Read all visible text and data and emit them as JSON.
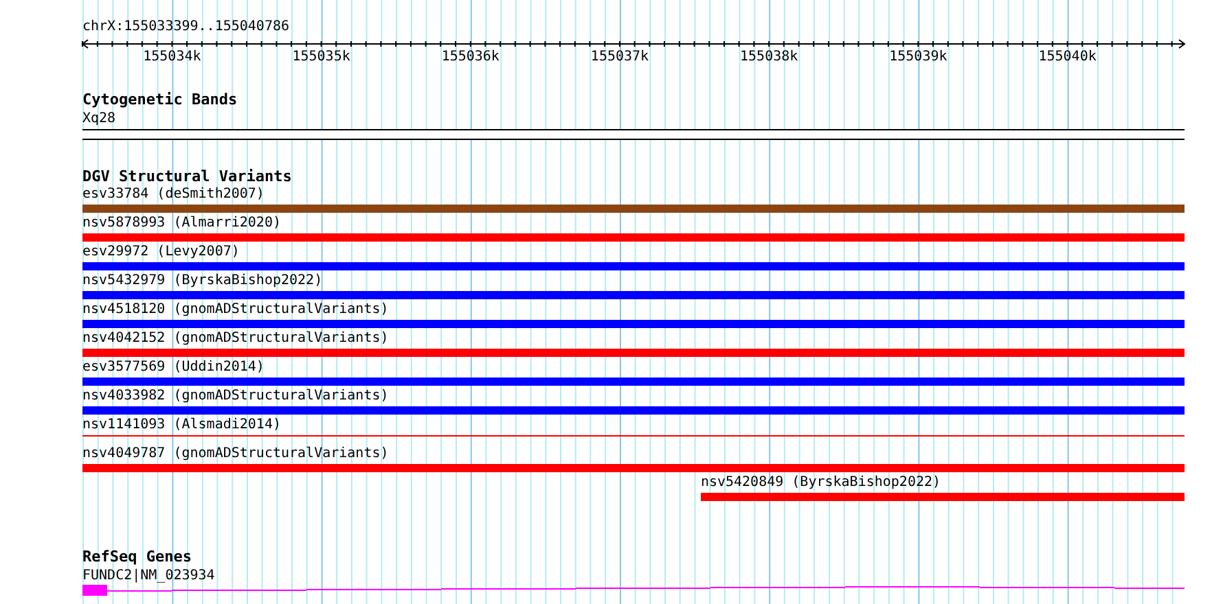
{
  "ruler": {
    "location": "chrX:155033399..155040786",
    "tick_labels": [
      "155034k",
      "155035k",
      "155036k",
      "155037k",
      "155038k",
      "155039k",
      "155040k"
    ]
  },
  "cytogenetic_bands": {
    "title": "Cytogenetic Bands",
    "band": "Xq28"
  },
  "dgv_structural_variants": {
    "title": "DGV Structural Variants",
    "variants": [
      {
        "label": "esv33784 (deSmith2007)",
        "color": "#8b4513",
        "level": 1,
        "kind": "thick"
      },
      {
        "label": "nsv5878993 (Almarri2020)",
        "color": "#ff0000",
        "level": 1,
        "kind": "thick"
      },
      {
        "label": "esv29972 (Levy2007)",
        "color": "#0000ff",
        "level": 1,
        "kind": "thick"
      },
      {
        "label": "nsv5432979 (ByrskaBishop2022)",
        "color": "#0000ff",
        "level": 1,
        "kind": "thick"
      },
      {
        "label": "nsv4518120 (gnomADStructuralVariants)",
        "color": "#0000ff",
        "level": 1,
        "kind": "thick"
      },
      {
        "label": "nsv4042152 (gnomADStructuralVariants)",
        "color": "#ff0000",
        "level": 1,
        "kind": "thick"
      },
      {
        "label": "esv3577569 (Uddin2014)",
        "color": "#0000ff",
        "level": 1,
        "kind": "thick"
      },
      {
        "label": "nsv4033982 (gnomADStructuralVariants)",
        "color": "#0000ff",
        "level": 1,
        "kind": "thick"
      },
      {
        "label": "nsv1141093 (Alsmadi2014)",
        "color": "#ff0000",
        "level": 1,
        "kind": "thin"
      },
      {
        "label": "nsv4049787 (gnomADStructuralVariants)",
        "color": "#ff0000",
        "level": 1,
        "kind": "thick"
      },
      {
        "label": "nsv5420849 (ByrskaBishop2022)",
        "color": "#ff0000",
        "level": 0.439,
        "kind": "thick"
      }
    ]
  },
  "refseq_genes": {
    "title": "RefSeq Genes",
    "gene": "FUNDC2|NM_023934"
  }
}
